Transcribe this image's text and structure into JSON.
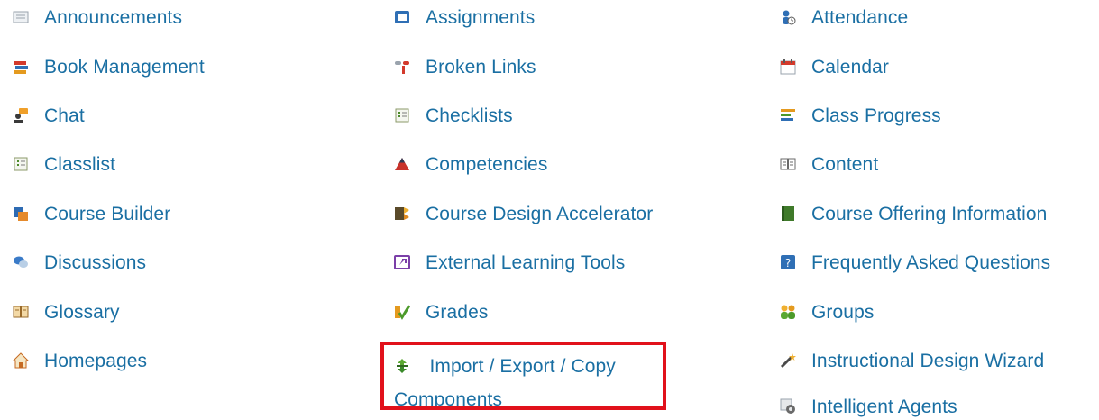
{
  "tools": {
    "announcements": "Announcements",
    "assignments": "Assignments",
    "attendance": "Attendance",
    "book_management": "Book Management",
    "broken_links": "Broken Links",
    "calendar": "Calendar",
    "chat": "Chat",
    "checklists": "Checklists",
    "class_progress": "Class Progress",
    "classlist": "Classlist",
    "competencies": "Competencies",
    "content": "Content",
    "course_builder": "Course Builder",
    "course_design_accelerator": "Course Design Accelerator",
    "course_offering_information": "Course Offering Information",
    "discussions": "Discussions",
    "external_learning_tools": "External Learning Tools",
    "frequently_asked_questions": "Frequently Asked Questions",
    "glossary": "Glossary",
    "grades": "Grades",
    "groups": "Groups",
    "homepages": "Homepages",
    "import_export_copy": "Import / Export / Copy Components",
    "instructional_design_wizard": "Instructional Design Wizard",
    "intelligent_agents": "Intelligent Agents"
  },
  "colors": {
    "link": "#1a6fa3",
    "highlight_border": "#e1111b"
  }
}
